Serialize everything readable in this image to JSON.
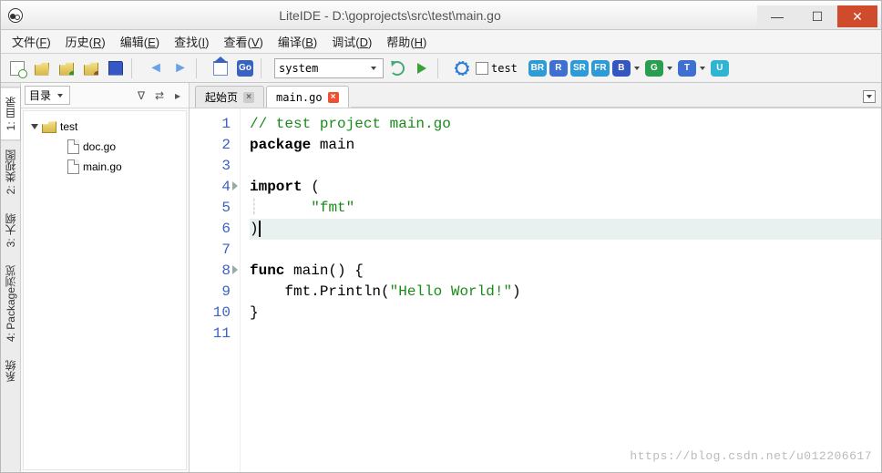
{
  "window": {
    "title": "LiteIDE - D:\\goprojects\\src\\test\\main.go"
  },
  "menubar": {
    "file": {
      "label": "文件",
      "accel": "F"
    },
    "history": {
      "label": "历史",
      "accel": "R"
    },
    "edit": {
      "label": "编辑",
      "accel": "E"
    },
    "find": {
      "label": "查找",
      "accel": "I"
    },
    "view": {
      "label": "查看",
      "accel": "V"
    },
    "build": {
      "label": "编译",
      "accel": "B"
    },
    "debug": {
      "label": "调试",
      "accel": "D"
    },
    "help": {
      "label": "帮助",
      "accel": "H"
    }
  },
  "toolbar": {
    "go_label": "Go",
    "env_value": "system",
    "test_label": "test",
    "badges": {
      "br": "BR",
      "r": "R",
      "sr": "SR",
      "fr": "FR",
      "b": "B",
      "g": "G",
      "t": "T",
      "u": "U"
    }
  },
  "left_tabs": {
    "t1": "1: 目录",
    "t2": "2: 类视图",
    "t3": "3: 大纲",
    "t4": "4: Package浏览",
    "t5": "系统"
  },
  "sidebar": {
    "selector": "目录",
    "root": "test",
    "files": [
      "doc.go",
      "main.go"
    ]
  },
  "editor": {
    "tabs": {
      "start": "起始页",
      "file": "main.go"
    },
    "line_numbers": [
      "1",
      "2",
      "3",
      "4",
      "5",
      "6",
      "7",
      "8",
      "9",
      "10",
      "11"
    ],
    "code": {
      "l1_comment": "// test project main.go",
      "l2_kw": "package",
      "l2_rest": " main",
      "l4_kw": "import",
      "l4_rest": " (",
      "l5": "    \"fmt\"",
      "l6": ")",
      "l8_kw": "func",
      "l8_rest": " main() {",
      "l9_pre": "    fmt.Println(",
      "l9_str": "\"Hello World!\"",
      "l9_post": ")",
      "l10": "}"
    }
  },
  "watermark": "https://blog.csdn.net/u012206617"
}
